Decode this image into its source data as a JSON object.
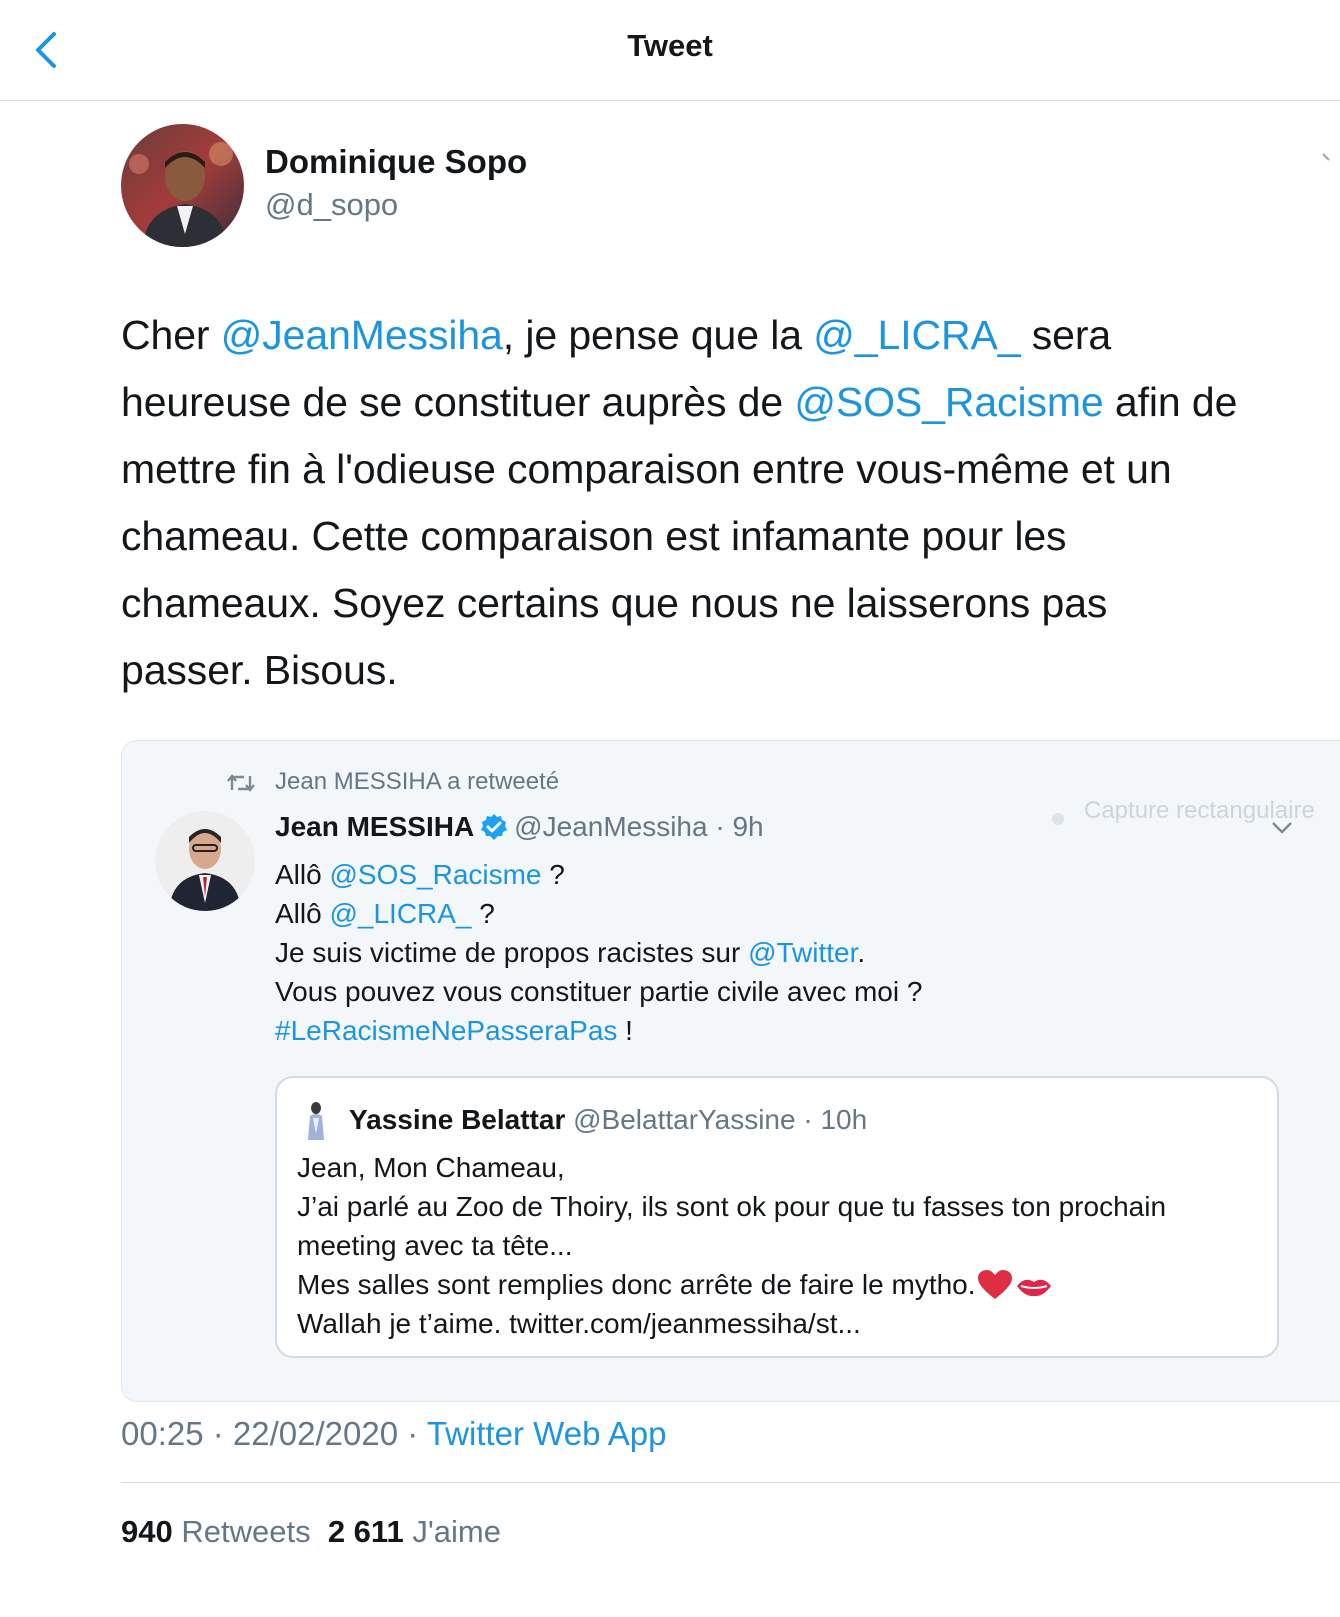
{
  "header": {
    "title": "Tweet"
  },
  "author": {
    "name": "Dominique Sopo",
    "handle": "@d_sopo"
  },
  "tweet": {
    "lines": [
      [
        {
          "t": "Cher ",
          "k": "text"
        },
        {
          "t": "@JeanMessiha",
          "k": "link"
        },
        {
          "t": ", je pense que la ",
          "k": "text"
        },
        {
          "t": "@_LICRA_",
          "k": "link"
        },
        {
          "t": " sera",
          "k": "text"
        }
      ],
      [
        {
          "t": "heureuse de se constituer auprès de ",
          "k": "text"
        },
        {
          "t": "@SOS_Racisme",
          "k": "link"
        },
        {
          "t": " afin de",
          "k": "text"
        }
      ],
      [
        {
          "t": "mettre fin à l'odieuse comparaison entre vous-même et un",
          "k": "text"
        }
      ],
      [
        {
          "t": "chameau. Cette comparaison est infamante pour les",
          "k": "text"
        }
      ],
      [
        {
          "t": "chameaux. Soyez certains que nous ne laisserons pas",
          "k": "text"
        }
      ],
      [
        {
          "t": "passer. Bisous.",
          "k": "text"
        }
      ]
    ]
  },
  "embed": {
    "retweet_label": "Jean MESSIHA a retweeté",
    "ghost_text": "Capture rectangulaire",
    "author_name": "Jean MESSIHA",
    "author_meta": "@JeanMessiha · 9h",
    "lines": [
      [
        {
          "t": "Allô ",
          "k": "text"
        },
        {
          "t": "@SOS_Racisme",
          "k": "link"
        },
        {
          "t": " ?",
          "k": "text"
        }
      ],
      [
        {
          "t": "Allô ",
          "k": "text"
        },
        {
          "t": "@_LICRA_",
          "k": "link"
        },
        {
          "t": " ?",
          "k": "text"
        }
      ],
      [
        {
          "t": "Je suis victime de propos racistes sur ",
          "k": "text"
        },
        {
          "t": "@Twitter",
          "k": "link"
        },
        {
          "t": ".",
          "k": "text"
        }
      ],
      [
        {
          "t": "Vous pouvez vous constituer partie civile avec moi ?",
          "k": "text"
        }
      ],
      [
        {
          "t": "#LeRacismeNePasseraPas",
          "k": "link"
        },
        {
          "t": " !",
          "k": "text"
        }
      ]
    ],
    "quote": {
      "author_name": "Yassine Belattar",
      "author_meta": "@BelattarYassine · 10h",
      "lines": [
        "Jean, Mon Chameau,",
        "J’ai parlé au Zoo de Thoiry, ils sont ok pour que tu fasses ton prochain",
        "meeting avec ta tête...",
        "Mes salles sont remplies donc arrête de faire le mytho.",
        "Wallah je t’aime. twitter.com/jeanmessiha/st..."
      ]
    }
  },
  "meta": {
    "time_date": "00:25 · 22/02/2020 · ",
    "source": "Twitter Web App"
  },
  "stats": {
    "retweets_count": "940",
    "retweets_label": "Retweets",
    "likes_count": "2 611",
    "likes_label": "J'aime"
  },
  "colors": {
    "link": "#1b95e0",
    "secondary": "#657786",
    "text": "#14171a"
  }
}
